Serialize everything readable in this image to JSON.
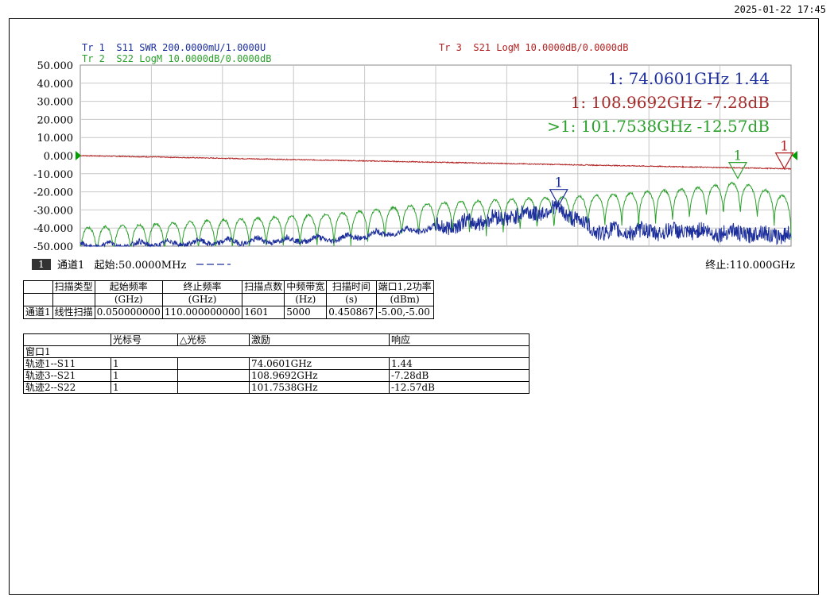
{
  "timestamp": "2025-01-22 17:45",
  "chart_data": {
    "type": "line",
    "ylim": [
      -50,
      50
    ],
    "y_ticks": [
      "50.000",
      "40.000",
      "30.000",
      "20.000",
      "10.000",
      "0.000",
      "-10.000",
      "-20.000",
      "-30.000",
      "-40.000",
      "-50.000"
    ],
    "xlim_ghz": [
      0.05,
      110
    ],
    "grid": true,
    "trace_labels": {
      "tr1": "Tr 1  S11 SWR 200.0000mU/1.0000U",
      "tr2": "Tr 2  S22 LogM 10.0000dB/0.0000dB",
      "tr3": "Tr 3  S21 LogM 10.0000dB/0.0000dB"
    },
    "marker_readouts": [
      {
        "text": "1:   74.0601GHz 1.44",
        "color": "#1c2e9c"
      },
      {
        "text": "1:  108.9692GHz -7.28dB",
        "color": "#a52a2a"
      },
      {
        "text": ">1:  101.7538GHz -12.57dB",
        "color": "#2ca02c"
      }
    ],
    "series": [
      {
        "name": "S21",
        "color": "#b22222",
        "display": [
          [
            0.05,
            0
          ],
          [
            110,
            -7.3
          ]
        ]
      },
      {
        "name": "S22",
        "color": "#2ca02c",
        "envelope_display": [
          [
            0.05,
            -38
          ],
          [
            40,
            -30
          ],
          [
            55,
            -24
          ],
          [
            80,
            -20
          ],
          [
            95,
            -16
          ],
          [
            101.75,
            -12.6
          ],
          [
            107,
            -18
          ],
          [
            110,
            -22
          ]
        ]
      },
      {
        "name": "S11",
        "color": "#1c2e9c",
        "envelope_display": [
          [
            0.05,
            -48
          ],
          [
            20,
            -46
          ],
          [
            40,
            -44
          ],
          [
            55,
            -38
          ],
          [
            74.06,
            -27.5
          ],
          [
            80,
            -40
          ],
          [
            95,
            -40
          ],
          [
            110,
            -42
          ]
        ]
      }
    ],
    "markers": [
      {
        "label": "1",
        "trace": "S11",
        "x_ghz": 74.0601,
        "display_y": -27.5,
        "color": "#1c2e9c"
      },
      {
        "label": "1",
        "trace": "S22",
        "x_ghz": 101.7538,
        "display_y": -12.57,
        "color": "#2ca02c"
      },
      {
        "label": "1",
        "trace": "S21",
        "x_ghz": 108.9692,
        "display_y": -7.28,
        "color": "#b22222"
      }
    ],
    "ref_arrow_color": "#00a000"
  },
  "channel_bar": {
    "num": "1",
    "label": "通道1   起始:50.0000MHz",
    "stop": "终止:110.000GHz"
  },
  "channel_table": {
    "headers": [
      "",
      "扫描类型",
      "起始频率",
      "终止频率",
      "扫描点数",
      "中频带宽",
      "扫描时间",
      "端口1,2功率"
    ],
    "units": [
      "",
      "",
      "(GHz)",
      "(GHz)",
      "",
      "(Hz)",
      "(s)",
      "(dBm)"
    ],
    "row": [
      "通道1",
      "线性扫描",
      "0.050000000",
      "110.000000000",
      "1601",
      "5000",
      "0.450867",
      "-5.00,-5.00"
    ]
  },
  "marker_table": {
    "headers": [
      "",
      "光标号",
      "△光标",
      "激励",
      "响应"
    ],
    "window_row": "窗口1",
    "rows": [
      [
        "轨迹1--S11",
        "1",
        "",
        "74.0601GHz",
        "1.44"
      ],
      [
        "轨迹3--S21",
        "1",
        "",
        "108.9692GHz",
        "-7.28dB"
      ],
      [
        "轨迹2--S22",
        "1",
        "",
        "101.7538GHz",
        "-12.57dB"
      ]
    ]
  }
}
